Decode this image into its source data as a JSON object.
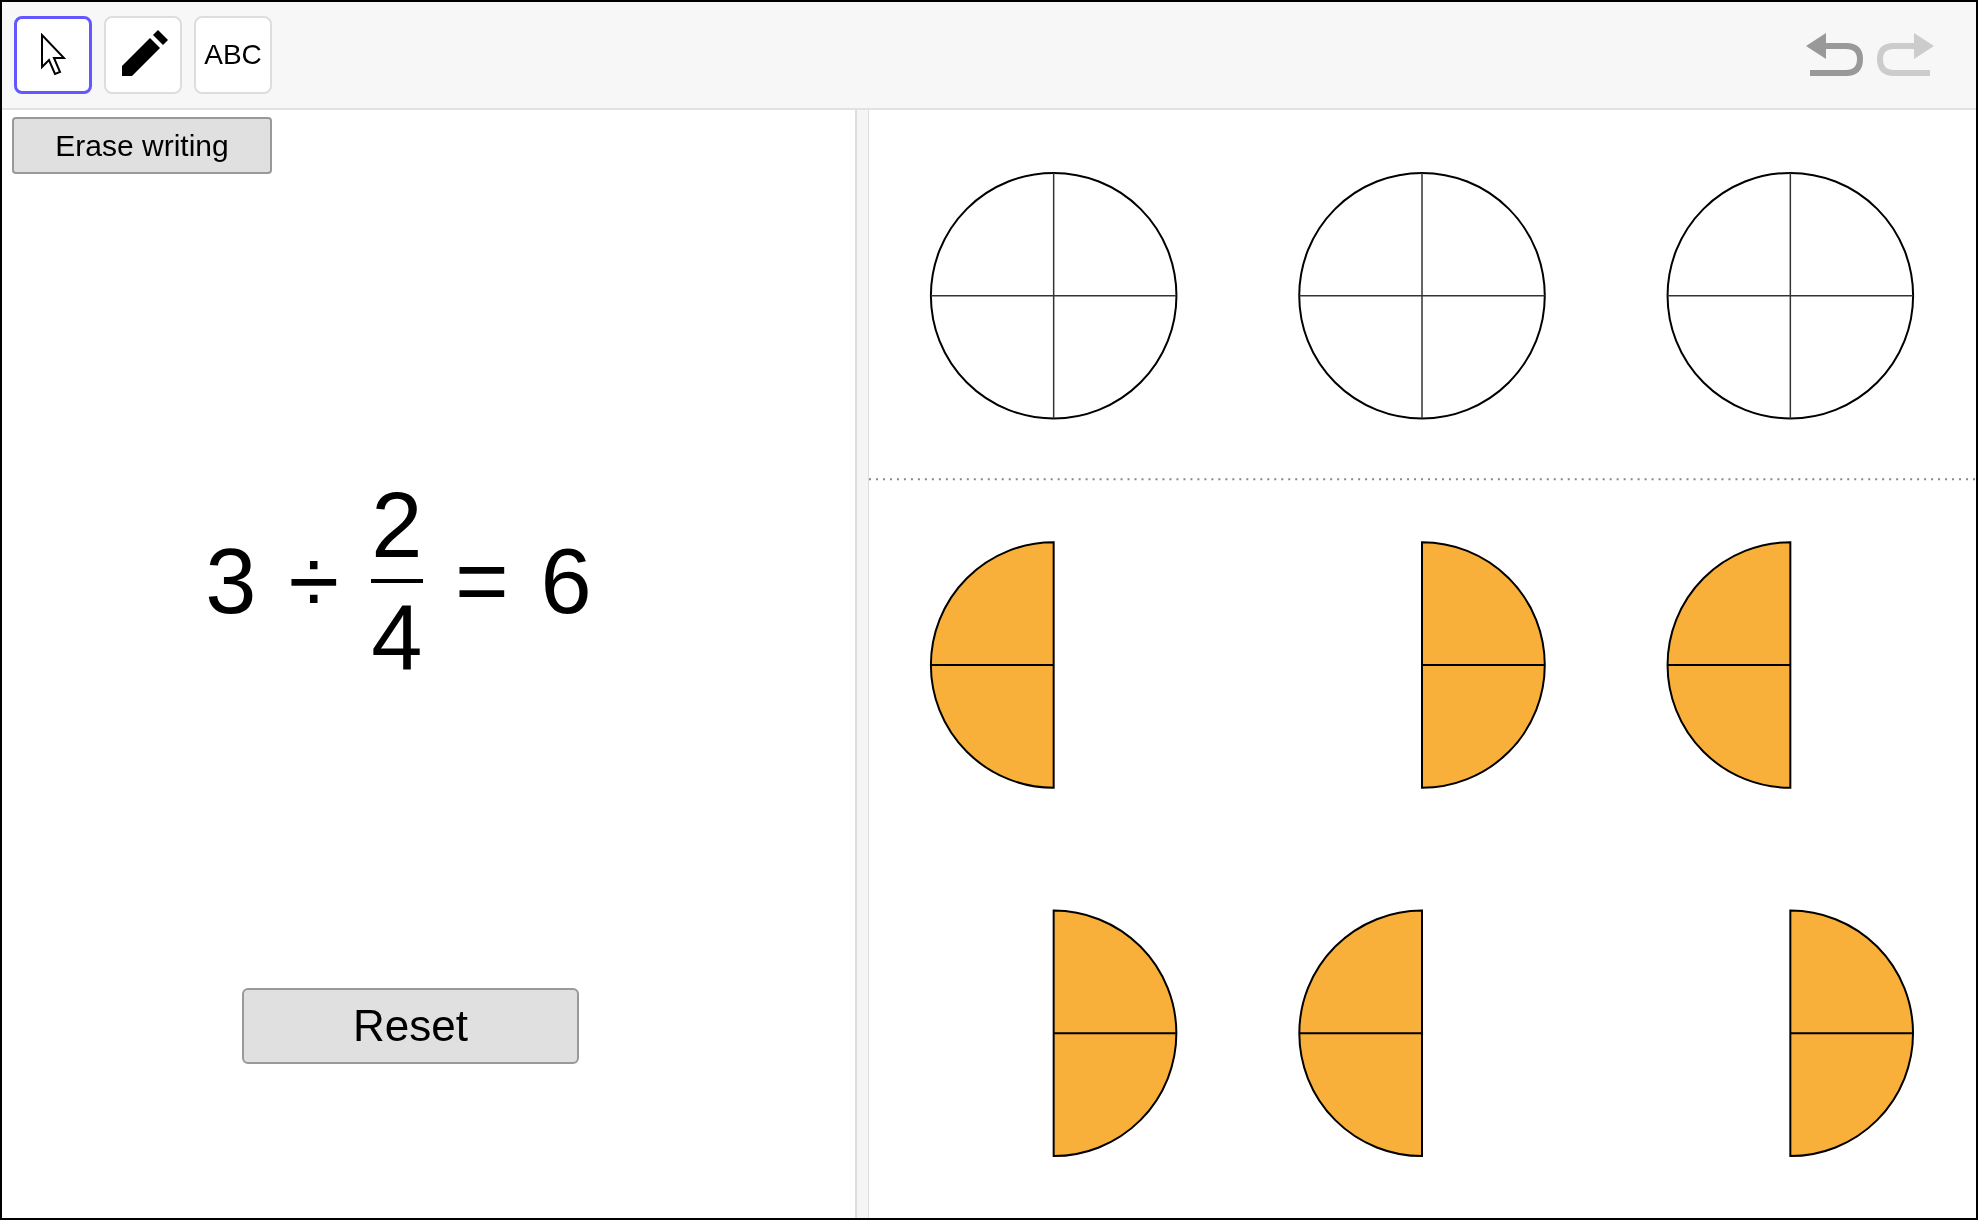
{
  "toolbar": {
    "tools": [
      {
        "kind": "select",
        "selected": true
      },
      {
        "kind": "pen",
        "selected": false
      },
      {
        "kind": "text",
        "label": "ABC",
        "selected": false
      }
    ],
    "undo": {
      "disabled": false
    },
    "redo": {
      "disabled": true
    }
  },
  "left_panel": {
    "erase_button": "Erase writing",
    "equation": {
      "dividend": "3",
      "operator": "÷",
      "numerator": "2",
      "denominator": "4",
      "equals": "=",
      "result": "6"
    },
    "reset_button": "Reset"
  },
  "canvas": {
    "rows": [
      {
        "shapes": [
          {
            "kind": "whole"
          },
          {
            "kind": "whole"
          },
          {
            "kind": "whole"
          }
        ]
      },
      {
        "shapes": [
          {
            "kind": "left-half"
          },
          {
            "kind": "right-half"
          },
          {
            "kind": "left-half"
          }
        ]
      },
      {
        "shapes": [
          {
            "kind": "right-half"
          },
          {
            "kind": "left-half"
          },
          {
            "kind": "right-half"
          }
        ]
      }
    ]
  }
}
